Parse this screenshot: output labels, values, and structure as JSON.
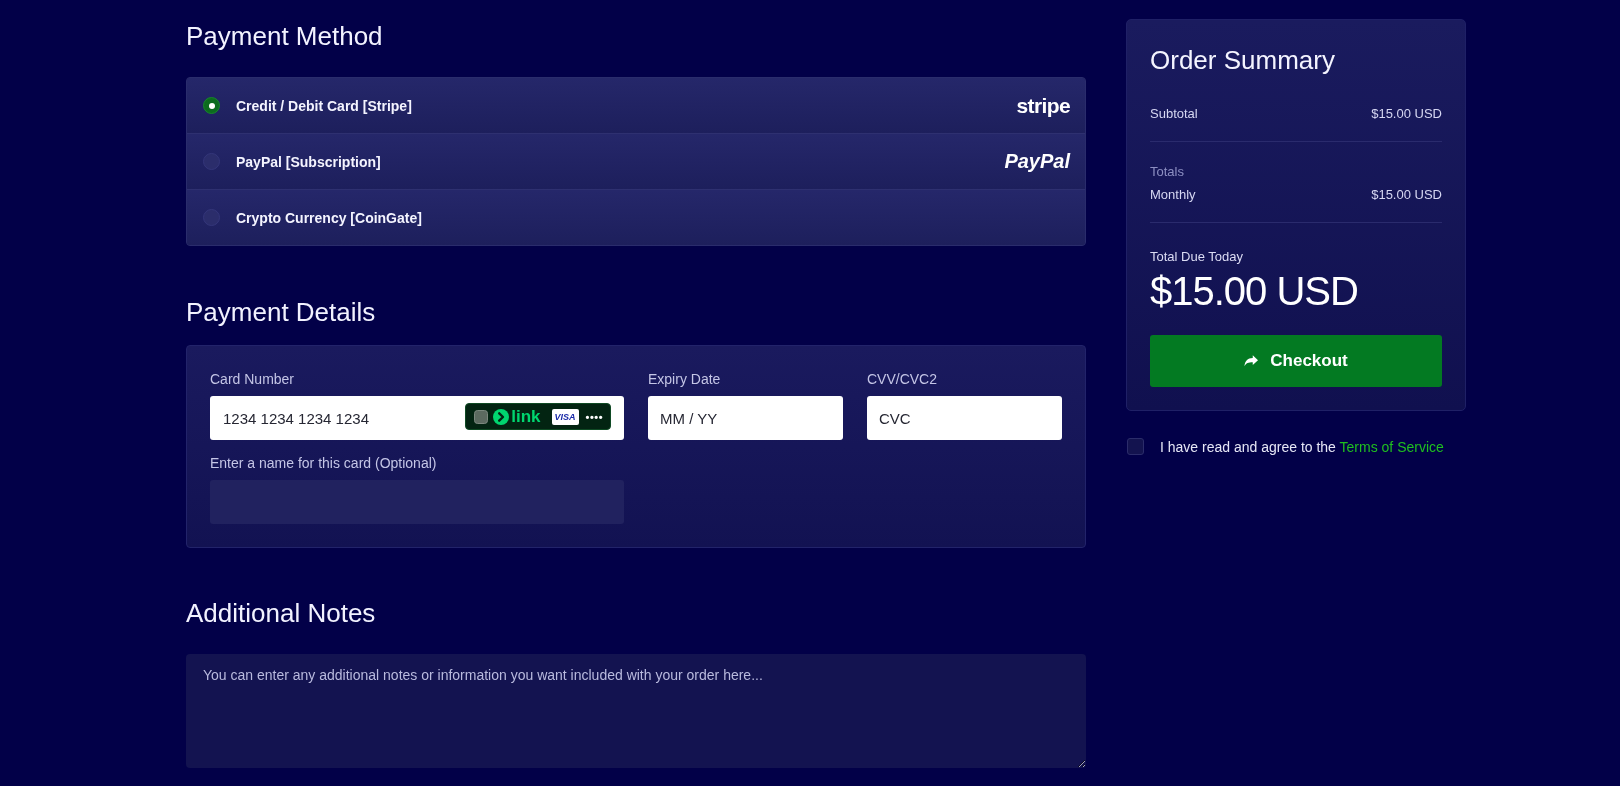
{
  "payment_method": {
    "heading": "Payment Method",
    "options": [
      {
        "label": "Credit / Debit Card [Stripe]",
        "selected": true,
        "logo": {
          "text": "stripe",
          "kind": "plain"
        }
      },
      {
        "label": "PayPal [Subscription]",
        "selected": false,
        "logo": {
          "text": "PayPal",
          "kind": "italic"
        }
      },
      {
        "label": "Crypto Currency [CoinGate]",
        "selected": false
      }
    ]
  },
  "payment_details": {
    "heading": "Payment Details",
    "card_number": {
      "label": "Card Number",
      "placeholder": "1234 1234 1234 1234",
      "badge": {
        "brand": "link",
        "card": "VISA",
        "more": "••••"
      }
    },
    "expiry": {
      "label": "Expiry Date",
      "placeholder": "MM / YY"
    },
    "cvv": {
      "label": "CVV/CVC2",
      "placeholder": "CVC"
    },
    "card_name": {
      "label": "Enter a name for this card (Optional)"
    }
  },
  "additional_notes": {
    "heading": "Additional Notes",
    "placeholder": "You can enter any additional notes or information you want included with your order here..."
  },
  "order_summary": {
    "title": "Order Summary",
    "lines": [
      {
        "label": "Subtotal",
        "amount": "$15.00 USD"
      }
    ],
    "totals_heading": "Totals",
    "totals": [
      {
        "label": "Monthly",
        "amount": "$15.00 USD"
      }
    ],
    "due_label": "Total Due Today",
    "due_amount": "$15.00 USD",
    "checkout": "Checkout"
  },
  "terms": {
    "checked": false,
    "text": "I have read and agree to the",
    "link": "Terms of Service"
  }
}
